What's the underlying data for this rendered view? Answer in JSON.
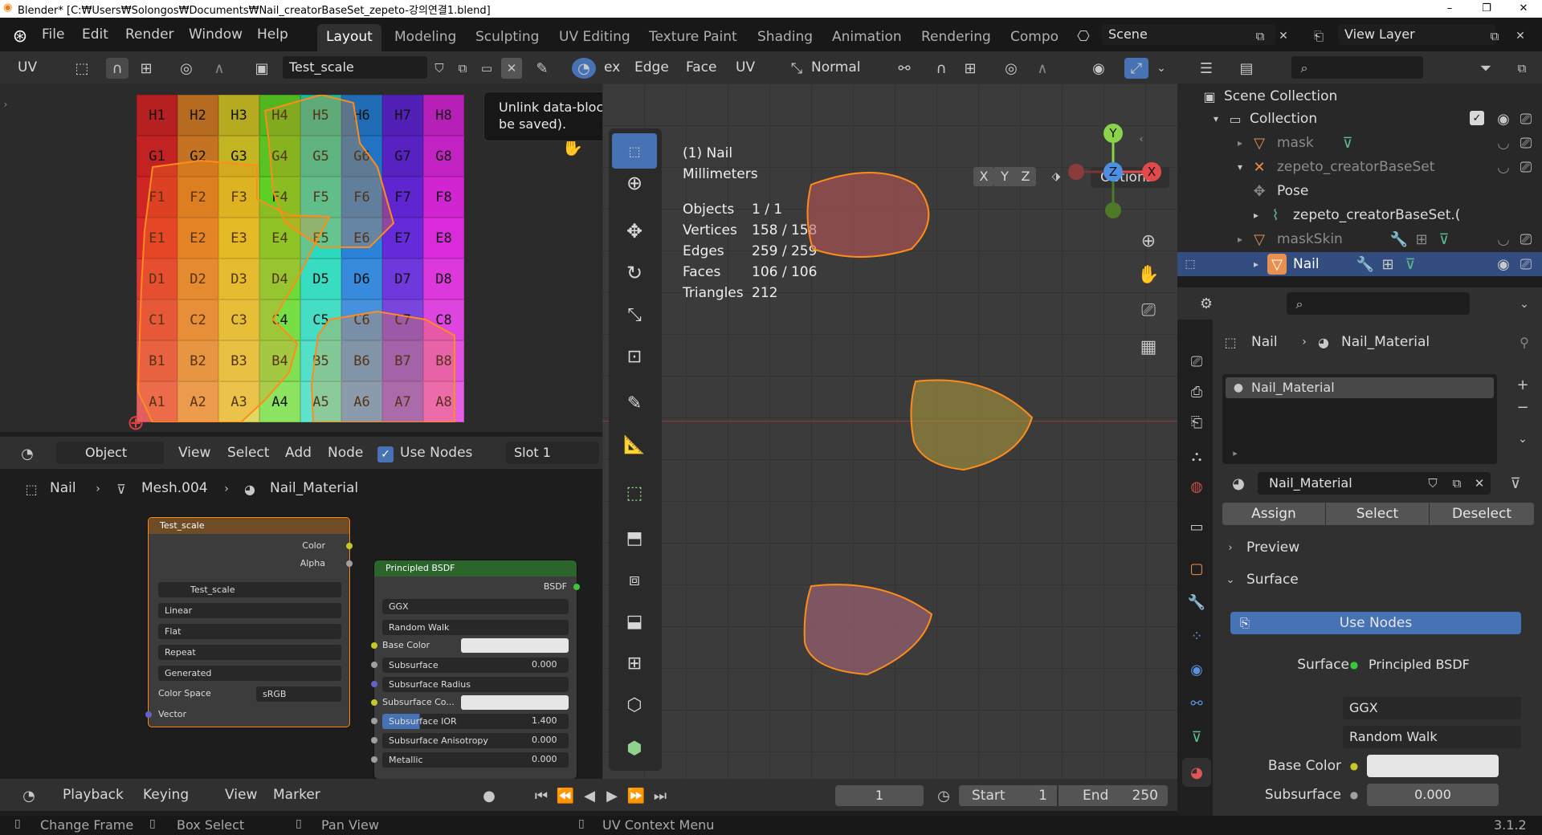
{
  "window": {
    "title": "Blender* [C:₩Users₩Solongos₩Documents₩Nail_creatorBaseSet_zepeto-강의연결1.blend]",
    "minimize": "–",
    "maximize": "❐",
    "close": "✕"
  },
  "menu": [
    "File",
    "Edit",
    "Render",
    "Window",
    "Help"
  ],
  "workspace_tabs": [
    "Layout",
    "Modeling",
    "Sculpting",
    "UV Editing",
    "Texture Paint",
    "Shading",
    "Animation",
    "Rendering",
    "Compo"
  ],
  "active_workspace": "Layout",
  "scene": {
    "name": "Scene",
    "view_layer": "View Layer"
  },
  "uv_editor": {
    "mode": "UV",
    "image": "Test_scale",
    "rows": [
      "H",
      "G",
      "F",
      "E",
      "D",
      "C",
      "B",
      "A"
    ],
    "cols": [
      "1",
      "2",
      "3",
      "4",
      "5",
      "6",
      "7",
      "8"
    ]
  },
  "tooltip": "Unlink data-block (Shift + Click to set users to zero, data will then not be saved).",
  "viewport_header": {
    "menus": [
      "ex",
      "Edge",
      "Face",
      "UV"
    ],
    "orientation": "Normal",
    "options": "Options",
    "axes": [
      "X",
      "Y",
      "Z"
    ]
  },
  "viewport_stats": {
    "object_name": "(1) Nail",
    "units": "Millimeters",
    "rows": [
      {
        "label": "Objects",
        "value": "1 / 1"
      },
      {
        "label": "Vertices",
        "value": "158 / 158"
      },
      {
        "label": "Edges",
        "value": "259 / 259"
      },
      {
        "label": "Faces",
        "value": "106 / 106"
      },
      {
        "label": "Triangles",
        "value": "212"
      }
    ]
  },
  "gizmo": {
    "x": "X",
    "y": "Y",
    "z": "Z"
  },
  "node_editor": {
    "mode": "Object",
    "menus": [
      "View",
      "Select",
      "Add",
      "Node"
    ],
    "use_nodes": "Use Nodes",
    "slot": "Slot 1",
    "breadcrumb": [
      "Nail",
      "Mesh.004",
      "Nail_Material"
    ]
  },
  "image_node": {
    "title": "Test_scale",
    "outputs": [
      "Color",
      "Alpha"
    ],
    "image": "Test_scale",
    "interpolation": "Linear",
    "projection": "Flat",
    "extension": "Repeat",
    "source": "Generated",
    "color_space_label": "Color Space",
    "color_space": "sRGB",
    "input": "Vector"
  },
  "bsdf_node": {
    "title": "Principled BSDF",
    "output": "BSDF",
    "distribution": "GGX",
    "subsurface_method": "Random Walk",
    "inputs": [
      {
        "label": "Base Color",
        "value": ""
      },
      {
        "label": "Subsurface",
        "value": "0.000"
      },
      {
        "label": "Subsurface Radius",
        "value": ""
      },
      {
        "label": "Subsurface Co...",
        "value": ""
      },
      {
        "label": "Subsurface IOR",
        "value": "1.400"
      },
      {
        "label": "Subsurface Anisotropy",
        "value": "0.000"
      },
      {
        "label": "Metallic",
        "value": "0.000"
      }
    ]
  },
  "outliner": {
    "root": "Scene Collection",
    "collection": "Collection",
    "items": [
      "mask",
      "zepeto_creatorBaseSet",
      "Pose",
      "zepeto_creatorBaseSet.(",
      "maskSkin",
      "Nail"
    ]
  },
  "properties": {
    "breadcrumb": [
      "Nail",
      "Nail_Material"
    ],
    "slot": "Nail_Material",
    "material": "Nail_Material",
    "buttons": [
      "Assign",
      "Select",
      "Deselect"
    ],
    "preview": "Preview",
    "surface_panel": "Surface",
    "use_nodes": "Use Nodes",
    "surface_label": "Surface",
    "surface_value": "Principled BSDF",
    "distribution": "GGX",
    "subsurface_method": "Random Walk",
    "base_color_label": "Base Color",
    "subsurface_label": "Subsurface",
    "subsurface_value": "0.000"
  },
  "timeline": {
    "menus": [
      "Playback",
      "Keying",
      "View",
      "Marker"
    ],
    "frame": "1",
    "start_label": "Start",
    "start": "1",
    "end_label": "End",
    "end": "250"
  },
  "status": {
    "items": [
      "Change Frame",
      "Box Select",
      "Pan View",
      "UV Context Menu"
    ],
    "version": "3.1.2"
  },
  "colors": {
    "accent": "#4772b3",
    "selected": "#334d80",
    "orange": "#ff8c1a",
    "node_green": "#2b652b"
  }
}
